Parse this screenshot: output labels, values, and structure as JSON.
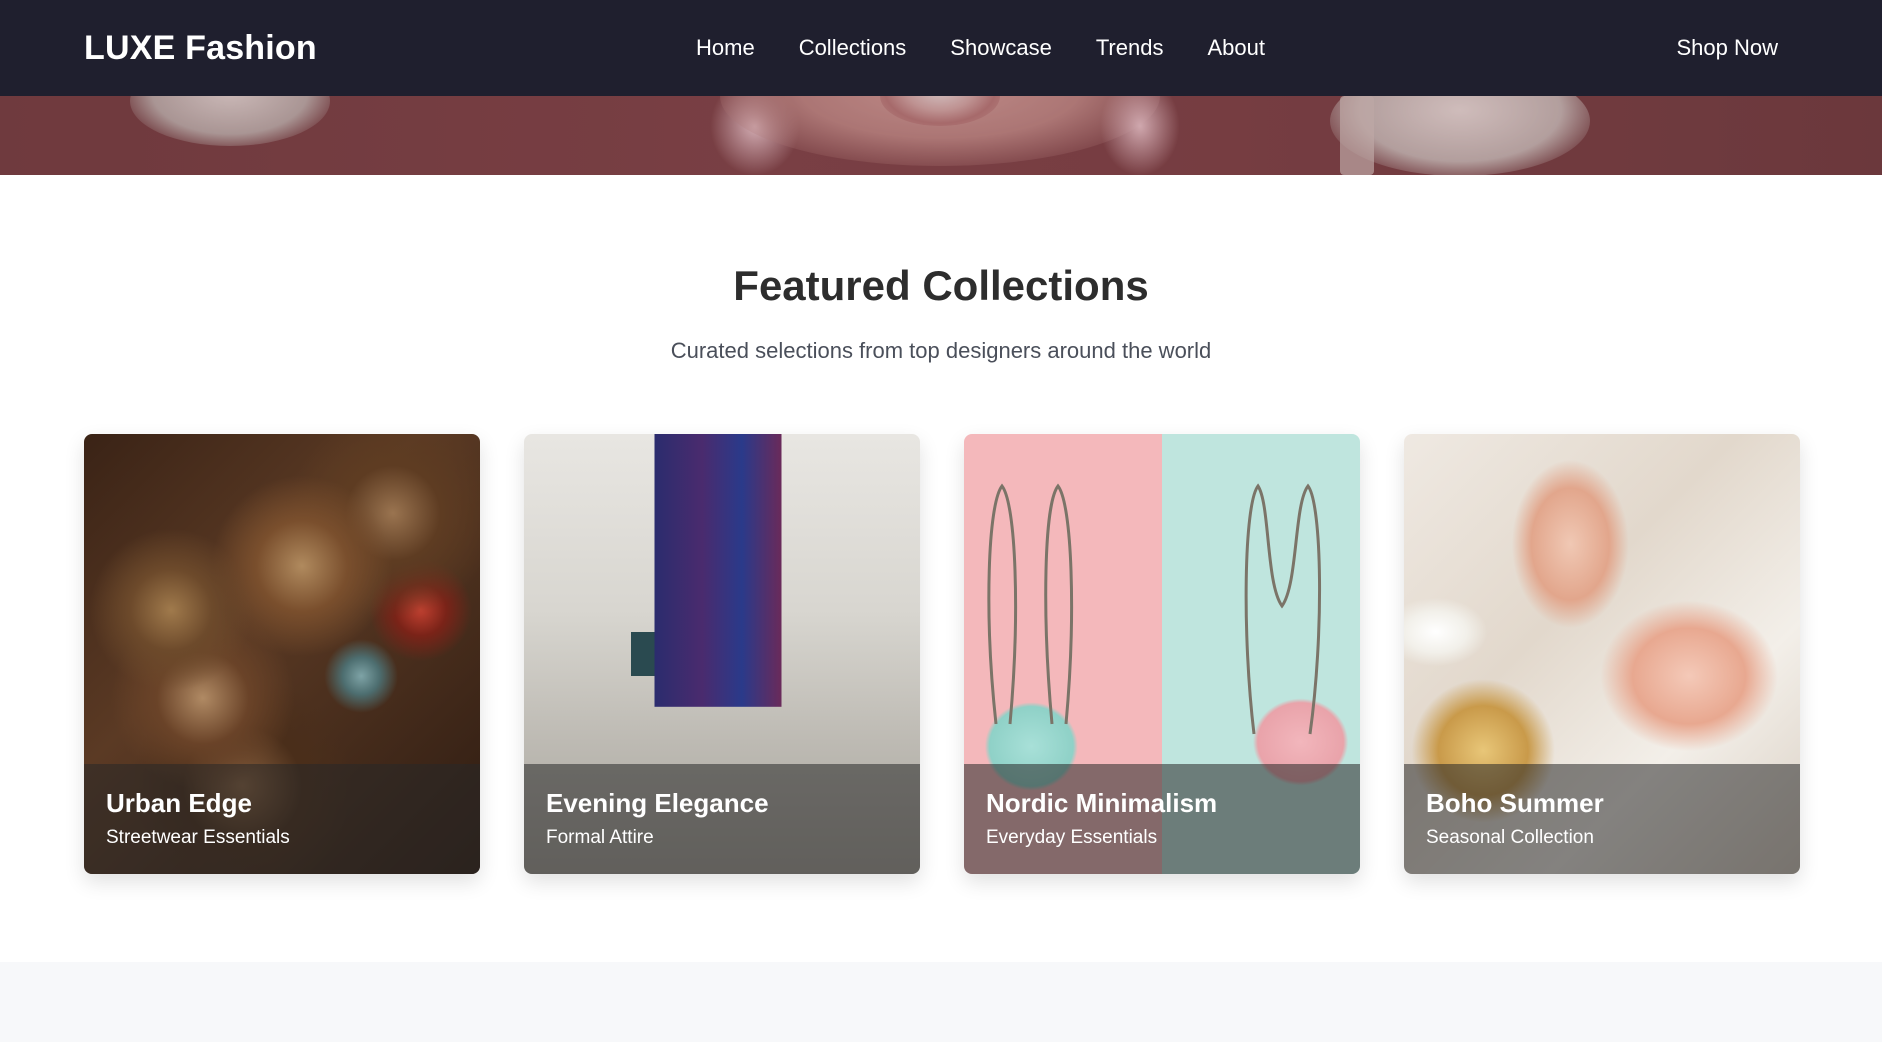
{
  "nav": {
    "brand": "LUXE Fashion",
    "links": [
      "Home",
      "Collections",
      "Showcase",
      "Trends",
      "About"
    ],
    "cta": "Shop Now"
  },
  "section": {
    "title": "Featured Collections",
    "subtitle": "Curated selections from top designers around the world"
  },
  "cards": [
    {
      "title": "Urban Edge",
      "subtitle": "Streetwear Essentials"
    },
    {
      "title": "Evening Elegance",
      "subtitle": "Formal Attire"
    },
    {
      "title": "Nordic Minimalism",
      "subtitle": "Everyday Essentials"
    },
    {
      "title": "Boho Summer",
      "subtitle": "Seasonal Collection"
    }
  ],
  "colors": {
    "navbar": "#1f1f2e",
    "heading": "#2d2d2d",
    "subtitle": "#4a4f5a"
  }
}
